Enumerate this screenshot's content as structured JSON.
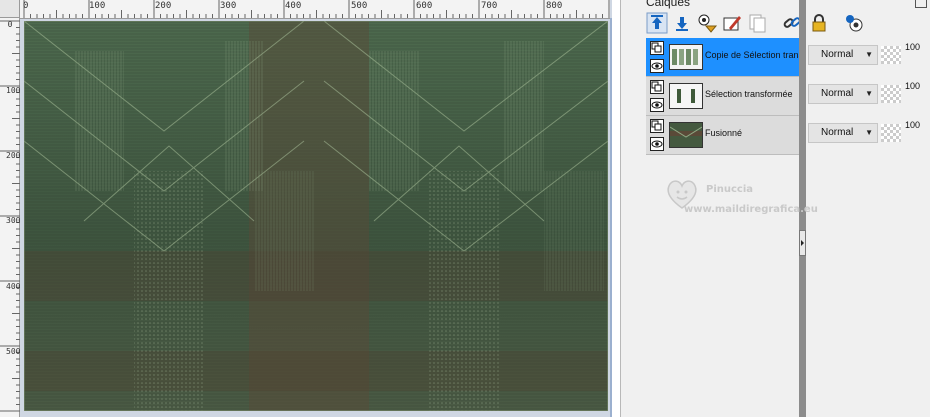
{
  "rulers": {
    "top": [
      "0",
      "100",
      "200",
      "300",
      "400",
      "500",
      "600",
      "700",
      "800"
    ],
    "left": [
      "0",
      "100",
      "200",
      "300",
      "400",
      "500"
    ]
  },
  "panel": {
    "title": "Calques",
    "toolbar": [
      {
        "name": "move-layer-up-icon"
      },
      {
        "name": "move-layer-down-icon"
      },
      {
        "name": "layer-visibility-icon"
      },
      {
        "name": "edit-layer-icon"
      },
      {
        "name": "copy-layer-icon"
      },
      {
        "name": "link-layer-icon"
      },
      {
        "name": "lock-layer-icon"
      },
      {
        "name": "mask-layer-icon"
      }
    ]
  },
  "layers": [
    {
      "name": "Copie de Sélection trans",
      "blend_mode": "Normal",
      "opacity": "100",
      "active": true
    },
    {
      "name": "Sélection transformée",
      "blend_mode": "Normal",
      "opacity": "100",
      "active": false
    },
    {
      "name": "Fusionné",
      "blend_mode": "Normal",
      "opacity": "100",
      "active": false
    }
  ],
  "watermark": {
    "name": "Pinuccia",
    "url": "www.maildiregrafica.eu"
  },
  "colors": {
    "active_layer": "#1e90ff",
    "canvas_green": "#4f6c4f",
    "canvas_brown": "#5a4a38"
  }
}
